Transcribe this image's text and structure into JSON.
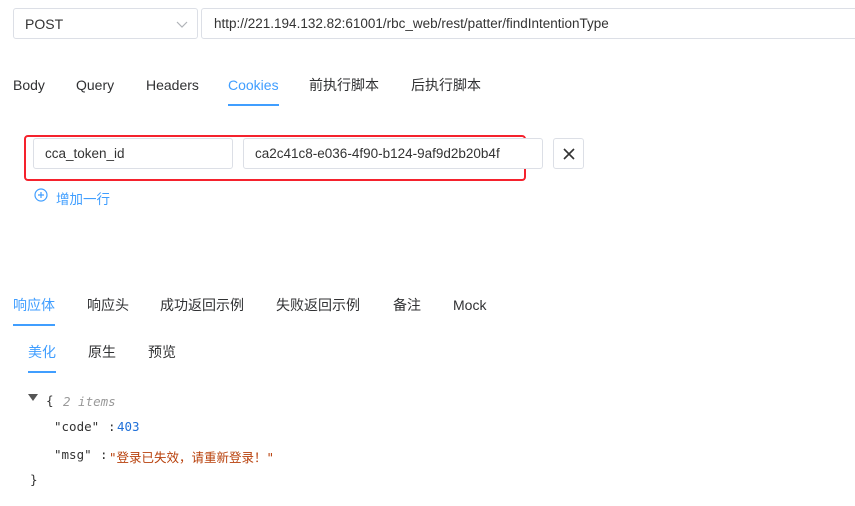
{
  "request": {
    "method": "POST",
    "url": "http://221.194.132.82:61001/rbc_web/rest/patter/findIntentionType"
  },
  "request_tabs": [
    {
      "label": "Body",
      "active": false
    },
    {
      "label": "Query",
      "active": false
    },
    {
      "label": "Headers",
      "active": false
    },
    {
      "label": "Cookies",
      "active": true
    },
    {
      "label": "前执行脚本",
      "active": false
    },
    {
      "label": "后执行脚本",
      "active": false
    }
  ],
  "cookies": {
    "rows": [
      {
        "name": "cca_token_id",
        "value": "ca2c41c8-e036-4f90-b124-9af9d2b20b4f"
      }
    ],
    "delete_label": "X",
    "add_row_label": "增加一行"
  },
  "response_tabs": [
    {
      "label": "响应体",
      "active": true
    },
    {
      "label": "响应头",
      "active": false
    },
    {
      "label": "成功返回示例",
      "active": false
    },
    {
      "label": "失败返回示例",
      "active": false
    },
    {
      "label": "备注",
      "active": false
    },
    {
      "label": "Mock",
      "active": false
    }
  ],
  "view_tabs": [
    {
      "label": "美化",
      "active": true
    },
    {
      "label": "原生",
      "active": false
    },
    {
      "label": "预览",
      "active": false
    }
  ],
  "response_json": {
    "open_brace": "{",
    "item_count": "2 items",
    "code_key": "\"code\"",
    "code_value": "403",
    "msg_key": "\"msg\"",
    "msg_value": "\"登录已失效，请重新登录！\"",
    "colon": ":",
    "close_brace": "}"
  },
  "colors": {
    "accent": "#409eff",
    "highlight_box": "#f5222d",
    "json_number": "#1e6fd8",
    "json_string": "#b8400b"
  }
}
